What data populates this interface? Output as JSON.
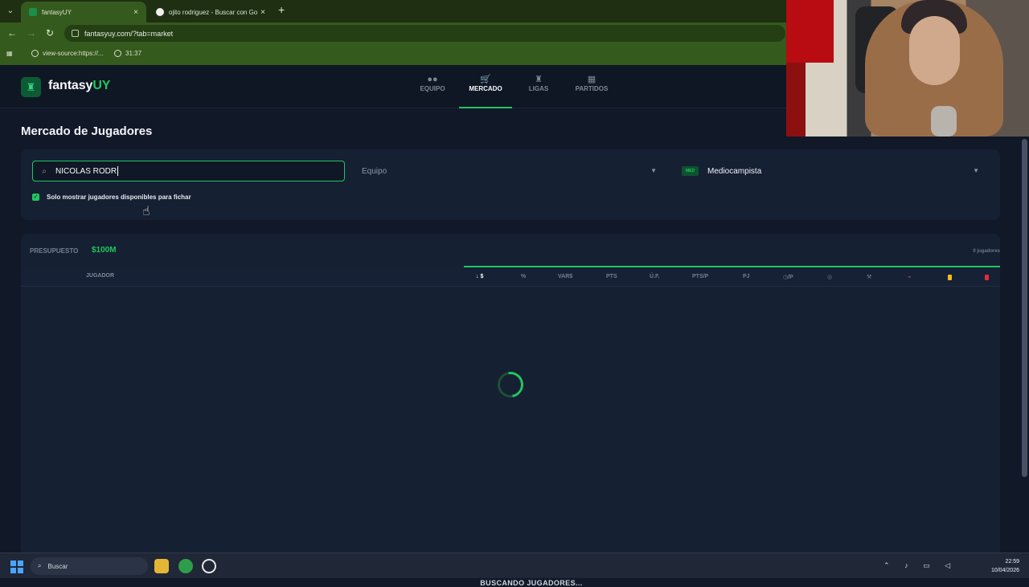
{
  "browser": {
    "tabs": [
      {
        "title": "fantasyUY",
        "favicon": "trophy-icon"
      },
      {
        "title": "ojito rodriguez - Buscar con Go",
        "favicon": "google-icon"
      }
    ],
    "address": "fantasyuy.com/?tab=market",
    "bookmarks": [
      {
        "label": "view-source:https://..."
      },
      {
        "label": "31:37"
      }
    ]
  },
  "app": {
    "logo": {
      "fantasy": "fantasy",
      "uy": "UY"
    },
    "nav": [
      {
        "label": "EQUIPO",
        "icon": "users-icon"
      },
      {
        "label": "MERCADO",
        "icon": "cart-icon"
      },
      {
        "label": "LIGAS",
        "icon": "trophy-icon"
      },
      {
        "label": "PARTIDOS",
        "icon": "calendar-icon"
      }
    ],
    "page_title": "Mercado de Jugadores",
    "filters": {
      "search_value": "NICOLAS RODR",
      "team_placeholder": "Equipo",
      "position_badge": "MED",
      "position_value": "Mediocampista",
      "available_only_label": "Solo mostrar jugadores disponibles para fichar"
    },
    "market": {
      "budget_label": "PRESUPUESTO",
      "budget_value": "$100M",
      "player_count": "0 jugadores",
      "columns": {
        "player": "JUGADOR",
        "price": "$",
        "percent": "%",
        "var": "VAR$",
        "pts": "PTS",
        "uf": "Ú.F.",
        "pts_per_game": "PTS/P",
        "pj": "PJ",
        "minutes": "/P"
      },
      "loading_text": "BUSCANDO JUGADORES..."
    }
  },
  "taskbar": {
    "search": "Buscar",
    "time": "22:59",
    "date": "10/04/2026"
  }
}
